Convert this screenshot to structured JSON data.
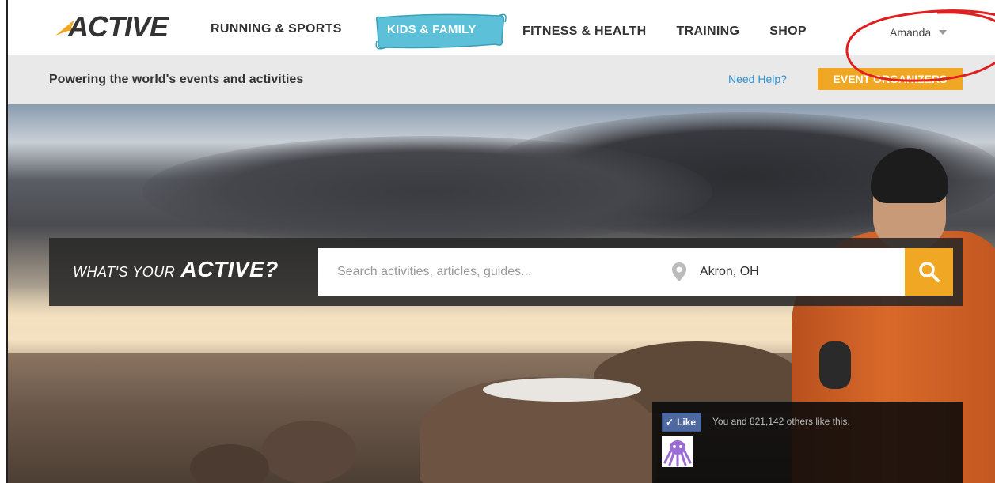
{
  "header": {
    "logo_text": "ACTIVE",
    "nav": [
      {
        "label": "RUNNING & SPORTS"
      },
      {
        "label": "KIDS & FAMILY"
      },
      {
        "label": "FITNESS & HEALTH"
      },
      {
        "label": "TRAINING"
      },
      {
        "label": "SHOP"
      }
    ],
    "user_name": "Amanda"
  },
  "subbar": {
    "tagline": "Powering the world's events and activities",
    "help_link": "Need Help?",
    "organizers_button": "EVENT ORGANIZERS"
  },
  "search": {
    "slogan_prefix": "WHAT'S YOUR",
    "slogan_brand": "ACTIVE?",
    "placeholder": "Search activities, articles, guides...",
    "location": "Akron, OH"
  },
  "facebook": {
    "like_label": "Like",
    "like_text": "You and 821,142 others like this."
  },
  "colors": {
    "accent_orange": "#f0a824",
    "kids_banner": "#5bc0d8",
    "link_blue": "#2a93d5",
    "annotation_red": "#e02020"
  }
}
